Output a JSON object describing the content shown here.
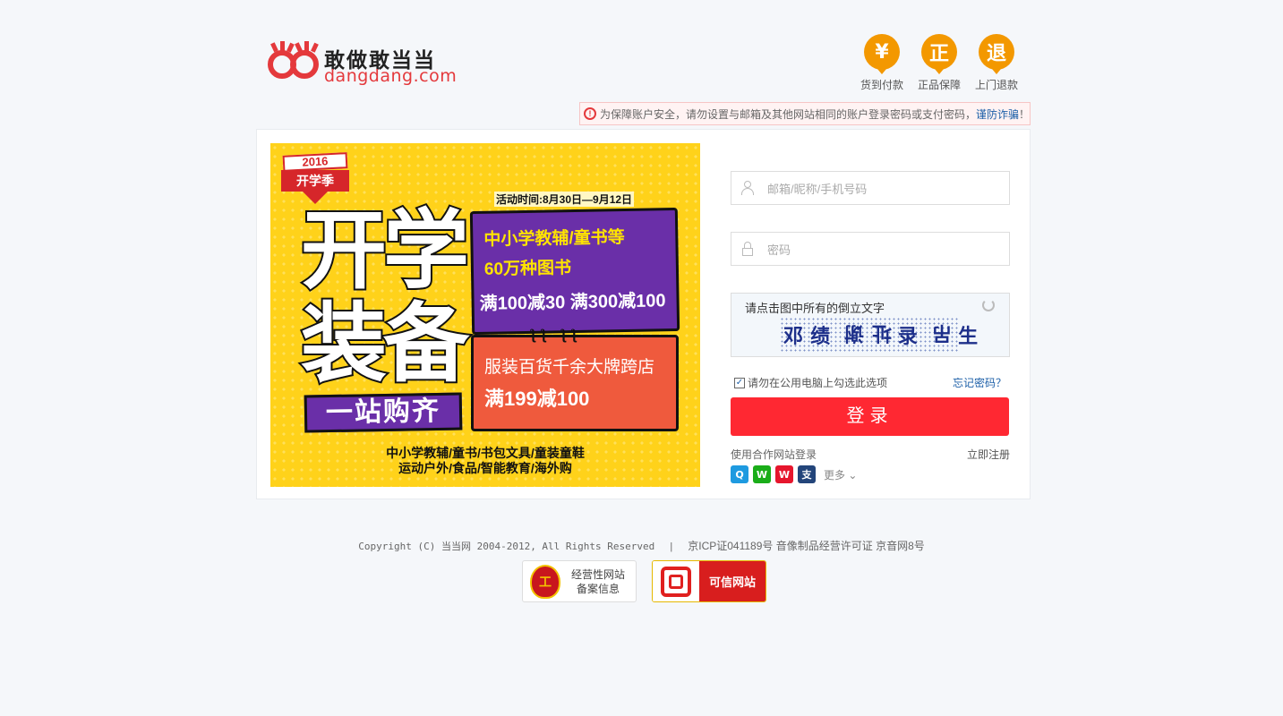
{
  "header": {
    "slogan": "敢做敢当当",
    "domain": "dangdang.com",
    "badges": [
      {
        "icon": "yuan-icon",
        "glyph": "¥",
        "label": "货到付款"
      },
      {
        "icon": "genuine-icon",
        "glyph": "正",
        "label": "正品保障"
      },
      {
        "icon": "return-icon",
        "glyph": "退",
        "label": "上门退款"
      }
    ]
  },
  "warning": {
    "text": "为保障账户安全，请勿设置与邮箱及其他网站相同的账户登录密码或支付密码，",
    "link": "谨防诈骗",
    "tail": "！"
  },
  "banner": {
    "year": "2016",
    "tag": "开学季",
    "activity_time": "活动时间:8月30日—9月12日",
    "title_line1": "开学",
    "title_line2": "装备",
    "sub_tag": "一站购齐",
    "purple_line1": "中小学教辅/童书等",
    "purple_line2": "60万种图书",
    "purple_line3": "满100减30 满300减100",
    "red_line1": "服装百货千余大牌跨店",
    "red_line2": "满199减100",
    "footer_line1": "中小学教辅/童书/书包文具/童装童鞋",
    "footer_line2": "运动户外/食品/智能教育/海外购"
  },
  "form": {
    "username_placeholder": "邮箱/昵称/手机号码",
    "password_placeholder": "密码",
    "captcha_hint": "请点击图中所有的倒立文字",
    "captcha_chars": [
      "邓",
      "绩",
      " ",
      "谢",
      "址",
      "录",
      " ",
      "吊",
      "生"
    ],
    "remember_label": "请勿在公用电脑上勾选此选项",
    "remember_checked": true,
    "forgot_label": "忘记密码？",
    "login_label": "登录",
    "partner_label": "使用合作网站登录",
    "register_label": "立即注册",
    "more_label": "更多",
    "socials": [
      {
        "icon": "qq-icon",
        "glyph": "Q",
        "color": "#1e9ae0"
      },
      {
        "icon": "wechat-icon",
        "glyph": "W",
        "color": "#1aad19"
      },
      {
        "icon": "weibo-icon",
        "glyph": "W",
        "color": "#e6162d"
      },
      {
        "icon": "alipay-icon",
        "glyph": "支",
        "color": "#23457a"
      }
    ]
  },
  "footer": {
    "copyright": "Copyright (C) 当当网 2004-2012, All Rights Reserved",
    "separator": "|",
    "icp": "京ICP证041189号 音像制品经营许可证 京音网8号",
    "seal1_line1": "经营性网站",
    "seal1_line2": "备案信息",
    "seal2_label": "可信网站"
  },
  "colors": {
    "brand_red": "#ff2832",
    "badge_orange": "#f39800",
    "link_blue": "#1c5fa8",
    "banner_yellow": "#ffd21a"
  }
}
